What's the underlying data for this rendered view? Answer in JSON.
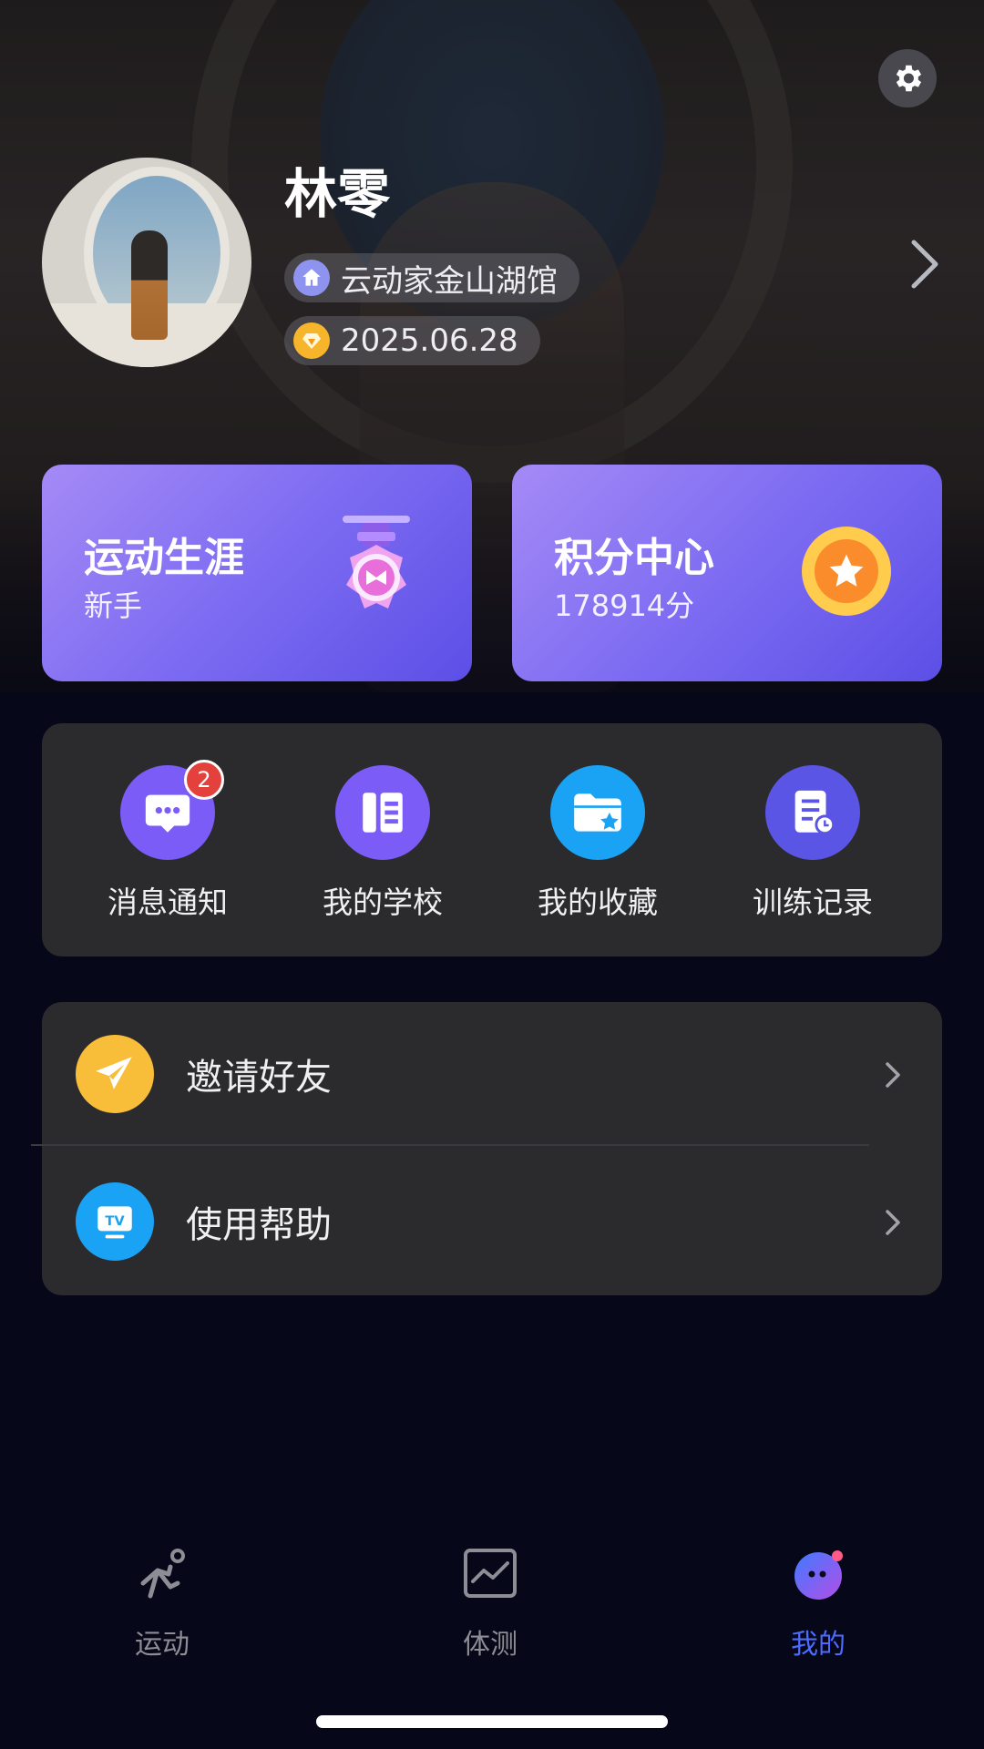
{
  "profile": {
    "name": "林零",
    "venue": "云动家金山湖馆",
    "date": "2025.06.28"
  },
  "cards": {
    "career": {
      "title": "运动生涯",
      "sub": "新手"
    },
    "points": {
      "title": "积分中心",
      "sub": "178914分"
    }
  },
  "quick": [
    {
      "label": "消息通知",
      "badge": "2",
      "color": "#7b5cf6",
      "icon": "message-icon"
    },
    {
      "label": "我的学校",
      "color": "#7b5cf6",
      "icon": "school-icon"
    },
    {
      "label": "我的收藏",
      "color": "#1aa3f5",
      "icon": "folder-star-icon"
    },
    {
      "label": "训练记录",
      "color": "#5b55e6",
      "icon": "record-icon"
    }
  ],
  "menu": [
    {
      "label": "邀请好友",
      "color": "#f8bd39",
      "icon": "paper-plane-icon"
    },
    {
      "label": "使用帮助",
      "color": "#1aa3f5",
      "icon": "tv-icon"
    }
  ],
  "tabs": [
    {
      "label": "运动",
      "icon": "running-icon",
      "active": false
    },
    {
      "label": "体测",
      "icon": "chart-icon",
      "active": false
    },
    {
      "label": "我的",
      "icon": "mascot-icon",
      "active": true
    }
  ],
  "colors": {
    "accent": "#4d6bff",
    "card_start": "#a58af6",
    "card_end": "#5c4fe6",
    "badge": "#e5413c"
  }
}
